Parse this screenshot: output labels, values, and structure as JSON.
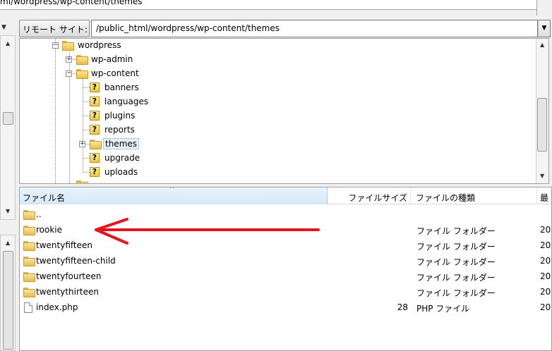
{
  "local": {
    "path_text": "ml/wordpress/wp-content/themes"
  },
  "remote": {
    "label": "リモート サイト:",
    "path": "/public_html/wordpress/wp-content/themes"
  },
  "tree": [
    {
      "label": "wordpress",
      "icon": "folder-icon",
      "expanded": true
    },
    {
      "label": "wp-admin",
      "icon": "folder-icon",
      "expanded": false
    },
    {
      "label": "wp-content",
      "icon": "folder-icon",
      "expanded": true
    },
    {
      "label": "banners",
      "icon": "unknown-folder-icon"
    },
    {
      "label": "languages",
      "icon": "unknown-folder-icon"
    },
    {
      "label": "plugins",
      "icon": "unknown-folder-icon"
    },
    {
      "label": "reports",
      "icon": "unknown-folder-icon"
    },
    {
      "label": "themes",
      "icon": "folder-icon",
      "expanded": false,
      "selected": true
    },
    {
      "label": "upgrade",
      "icon": "unknown-folder-icon"
    },
    {
      "label": "uploads",
      "icon": "unknown-folder-icon"
    }
  ],
  "file_list": {
    "columns": {
      "name": "ファイル名",
      "size": "ファイルサイズ",
      "type": "ファイルの種類",
      "date": "最"
    },
    "rows": [
      {
        "name": "..",
        "size": "",
        "type": "",
        "date": "",
        "icon": "folder-icon"
      },
      {
        "name": "rookie",
        "size": "",
        "type": "ファイル フォルダー",
        "date": "20",
        "icon": "folder-icon"
      },
      {
        "name": "twentyfifteen",
        "size": "",
        "type": "ファイル フォルダー",
        "date": "20",
        "icon": "folder-icon"
      },
      {
        "name": "twentyfifteen-child",
        "size": "",
        "type": "ファイル フォルダー",
        "date": "20",
        "icon": "folder-icon"
      },
      {
        "name": "twentyfourteen",
        "size": "",
        "type": "ファイル フォルダー",
        "date": "20",
        "icon": "folder-icon"
      },
      {
        "name": "twentythirteen",
        "size": "",
        "type": "ファイル フォルダー",
        "date": "20",
        "icon": "folder-icon"
      },
      {
        "name": "index.php",
        "size": "28",
        "type": "PHP ファイル",
        "date": "20",
        "icon": "file-icon"
      }
    ]
  },
  "annotation": {
    "color": "#e8141c",
    "points_to": "rookie"
  }
}
